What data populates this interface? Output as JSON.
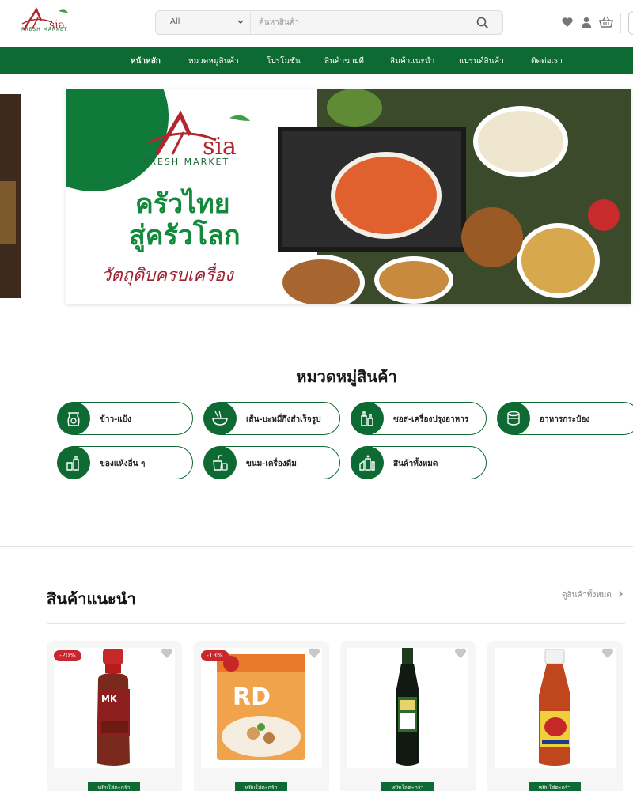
{
  "header": {
    "logo_text": "Asia",
    "logo_sub": "FRESH MARKET",
    "search": {
      "category": "All",
      "placeholder": "ค้นหาสินค้า"
    },
    "icons": [
      "heart-icon",
      "user-icon",
      "basket-icon",
      "search-icon",
      "chevron-down-icon"
    ]
  },
  "nav": {
    "items": [
      "หน้าหลัก",
      "หมวดหมู่สินค้า",
      "โปรโมชั่น",
      "สินค้าขายดี",
      "สินค้าแนะนำ",
      "แบรนด์สินค้า",
      "ติดต่อเรา"
    ],
    "active_index": 0,
    "color": "#0d6a32"
  },
  "hero": {
    "logo_text": "Asia",
    "logo_sub": "FRESH MARKET",
    "title_line1": "ครัวไทย",
    "title_line2": "สู่ครัวโลก",
    "tagline": "วัตถุดิบครบเครื่อง"
  },
  "categories": {
    "title": "หมวดหมู่สินค้า",
    "items": [
      {
        "label": "ข้าว-แป้ง",
        "icon": "rice-sack-icon"
      },
      {
        "label": "เส้น-บะหมี่กึ่งสำเร็จรูป",
        "icon": "noodle-bowl-icon"
      },
      {
        "label": "ซอส-เครื่องปรุงอาหาร",
        "icon": "sauce-bottles-icon"
      },
      {
        "label": "อาหารกระป๋อง",
        "icon": "canned-food-icon"
      },
      {
        "label": "ของแห้งอื่น ๆ",
        "icon": "dry-goods-icon"
      },
      {
        "label": "ขนม-เครื่องดื่ม",
        "icon": "snack-drink-icon"
      },
      {
        "label": "สินค้าทั้งหมด",
        "icon": "all-products-icon"
      }
    ]
  },
  "recommended": {
    "title": "สินค้าแนะนำ",
    "view_all": "ดูสินค้าทั้งหมด",
    "products": [
      {
        "badge": "-20%",
        "button": "หยิบใส่ตะกร้า",
        "image": "mk-sauce-bottle"
      },
      {
        "badge": "-13%",
        "button": "หยิบใส่ตะกร้า",
        "image": "rosdee-seasoning-pack"
      },
      {
        "badge": "",
        "button": "หยิบใส่ตะกร้า",
        "image": "dark-soy-sauce-bottle"
      },
      {
        "badge": "",
        "button": "หยิบใส่ตะกร้า",
        "image": "fish-sauce-bottle"
      }
    ]
  },
  "colors": {
    "brand_green": "#0d6a32",
    "brand_red": "#b3262e",
    "badge_red": "#c9262d"
  }
}
